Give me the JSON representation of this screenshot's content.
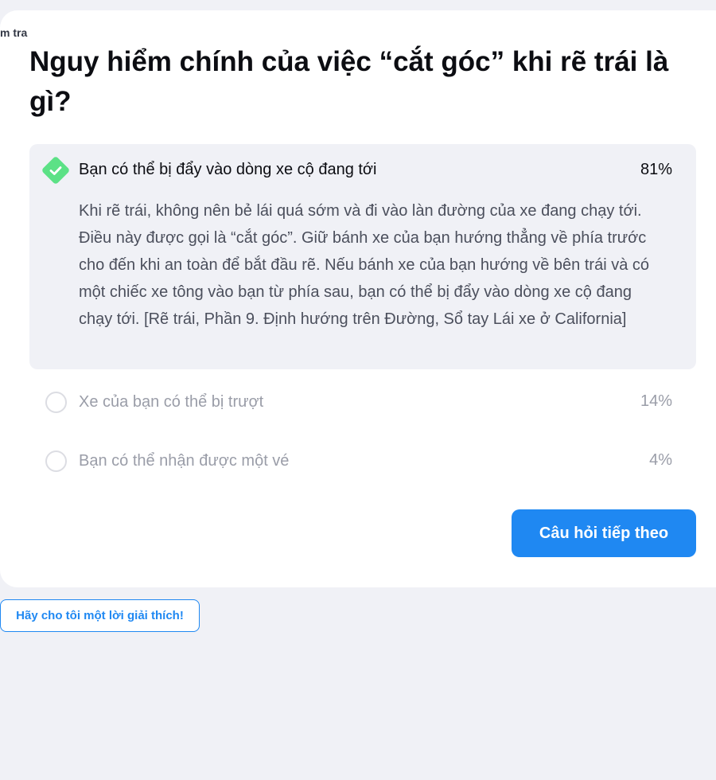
{
  "header": {
    "test_label": "m tra"
  },
  "question": {
    "text": "Nguy hiểm chính của việc “cắt góc” khi rẽ trái là gì?"
  },
  "answers": [
    {
      "label": "Bạn có thể bị đẩy vào dòng xe cộ đang tới",
      "percent": "81%",
      "correct": true,
      "explanation": "Khi rẽ trái, không nên bẻ lái quá sớm và đi vào làn đường của xe đang chạy tới. Điều này được gọi là “cắt góc”. Giữ bánh xe của bạn hướng thẳng về phía trước cho đến khi an toàn để bắt đầu rẽ. Nếu bánh xe của bạn hướng về bên trái và có một chiếc xe tông vào bạn từ phía sau, bạn có thể bị đẩy vào dòng xe cộ đang chạy tới. [Rẽ trái, Phần 9. Định hướng trên Đường, Sổ tay Lái xe ở California]"
    },
    {
      "label": "Xe của bạn có thể bị trượt",
      "percent": "14%",
      "correct": false
    },
    {
      "label": "Bạn có thể nhận được một vé",
      "percent": "4%",
      "correct": false
    }
  ],
  "buttons": {
    "next_label": "Câu hỏi tiếp theo",
    "explain_label": "Hãy cho tôi một lời giải thích!"
  },
  "colors": {
    "accent": "#1f88f2",
    "correct": "#5ce186",
    "background": "#f0f1f6"
  },
  "icons": {
    "correct": "check-diamond-icon",
    "unselected": "radio-circle-icon"
  }
}
